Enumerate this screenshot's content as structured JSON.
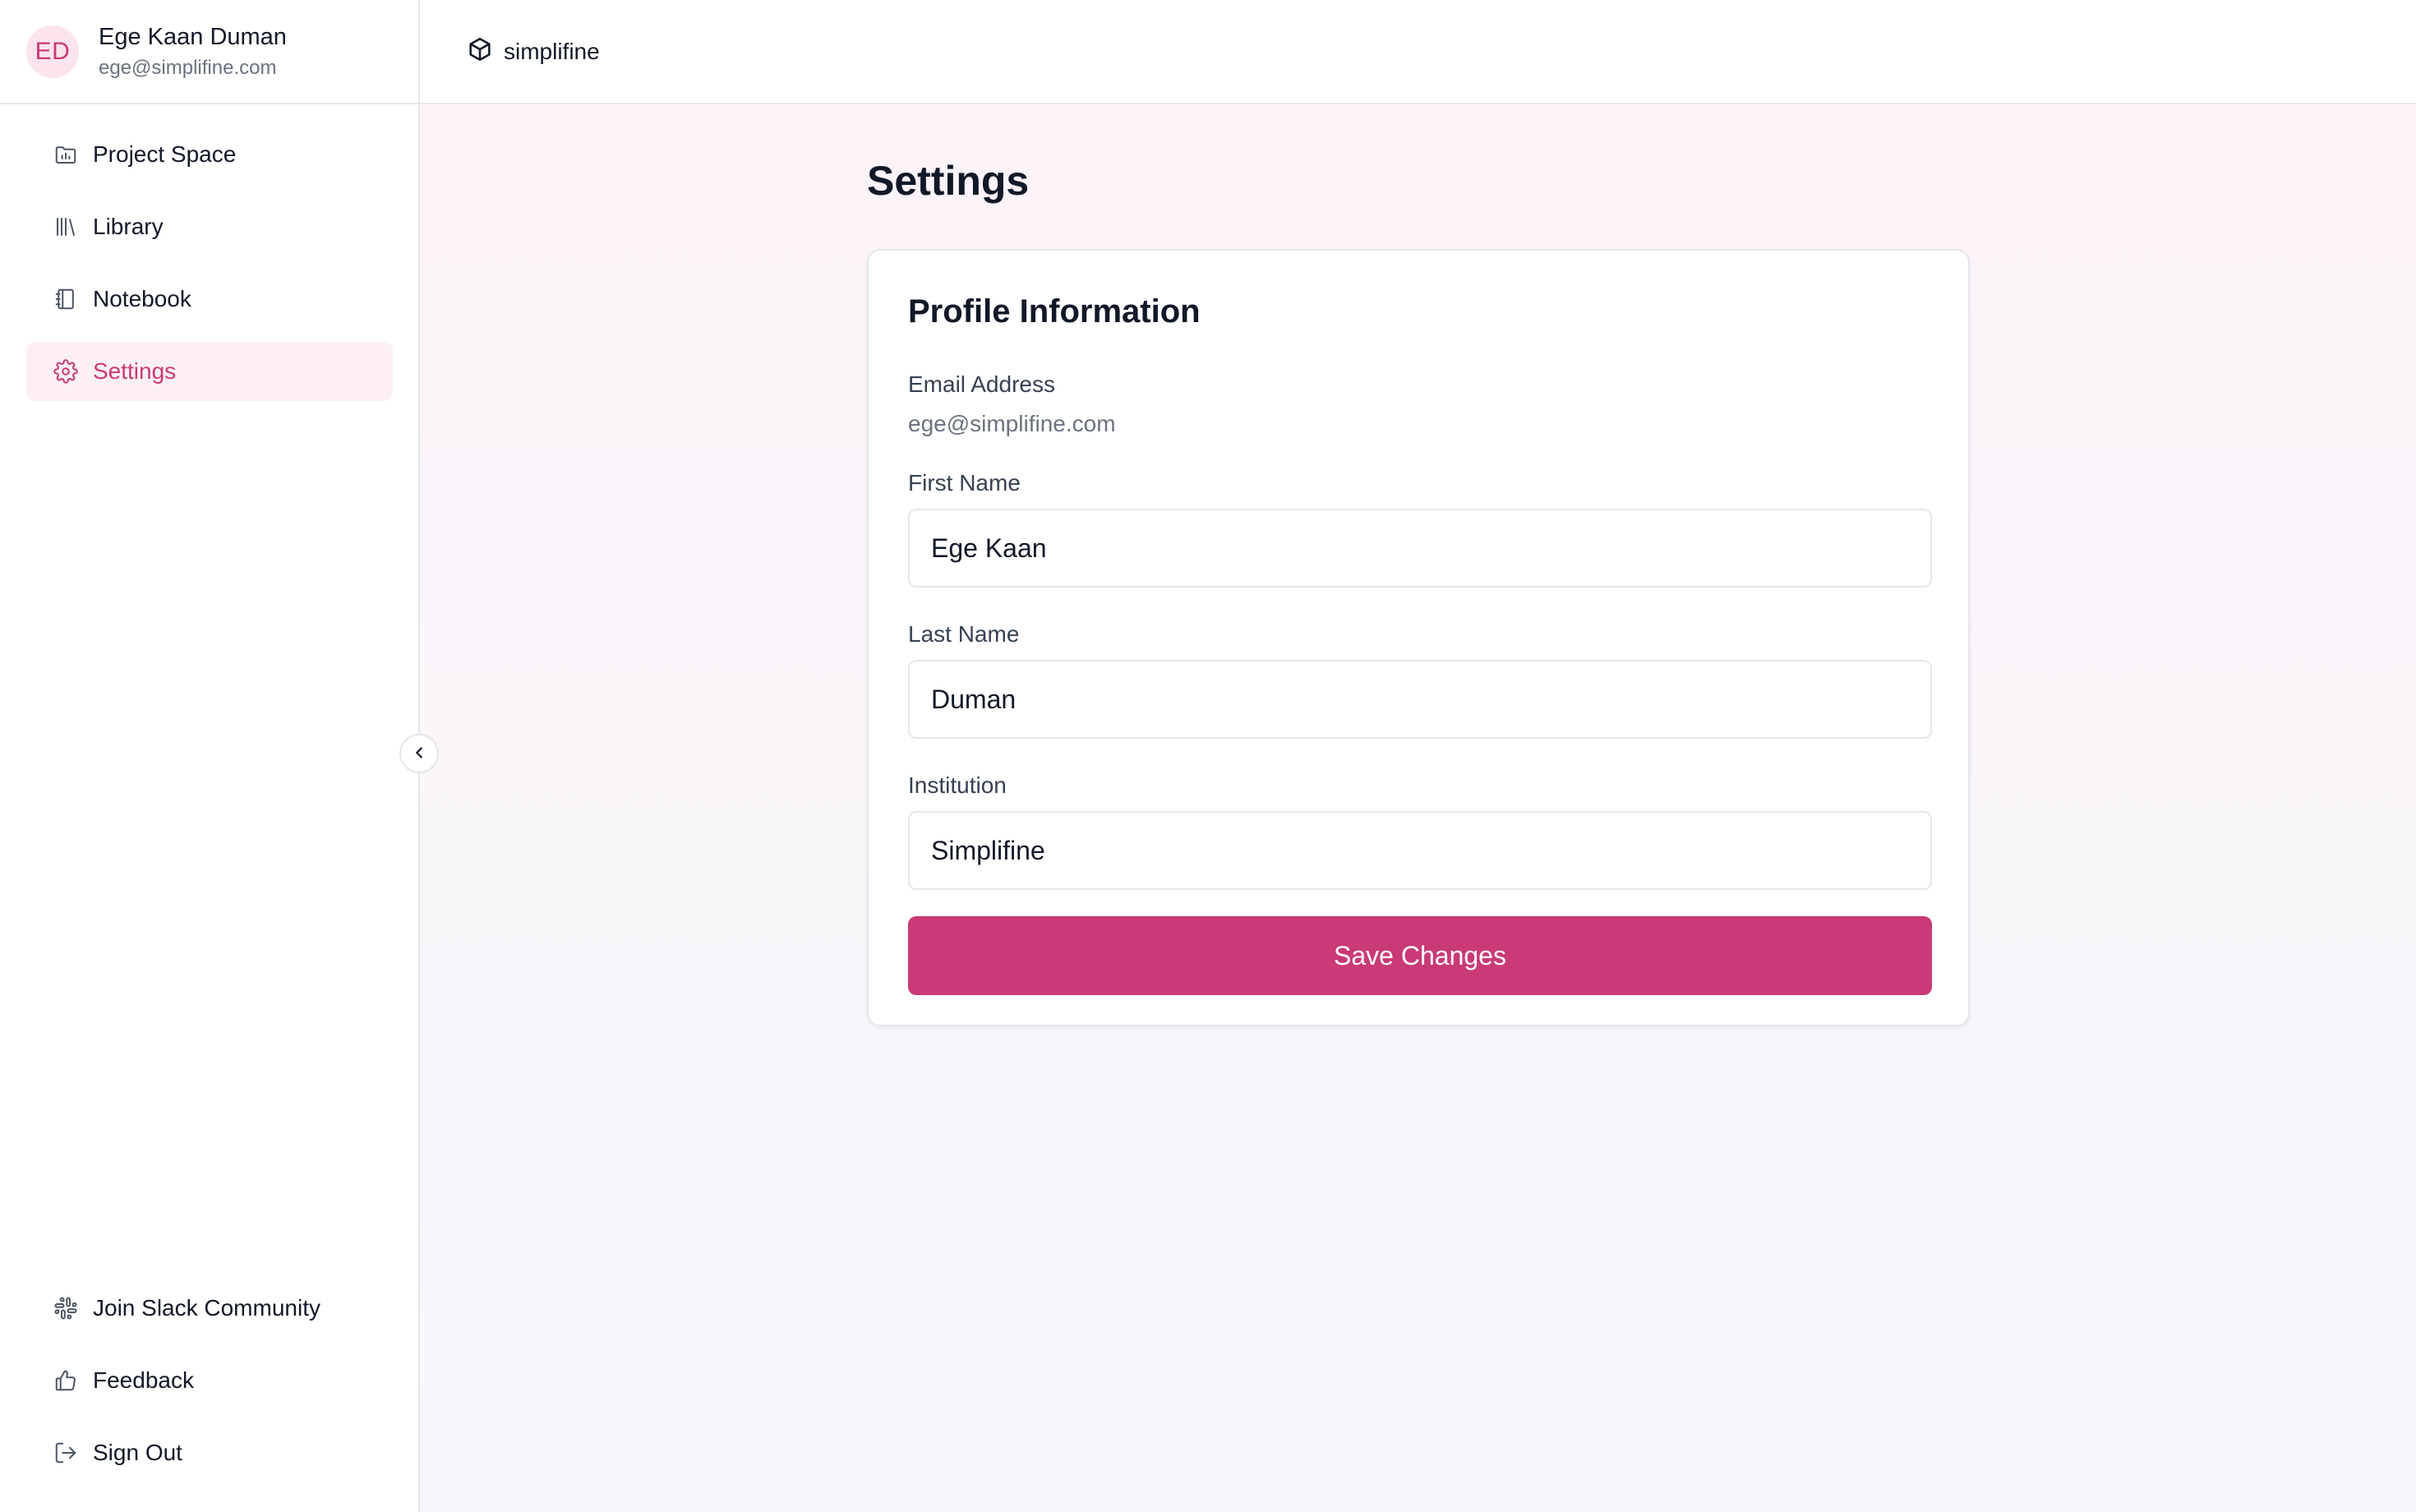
{
  "user": {
    "initials": "ED",
    "name": "Ege Kaan Duman",
    "email": "ege@simplifine.com"
  },
  "brand": {
    "name": "simplifine",
    "icon": "cube-logo-icon"
  },
  "nav": {
    "items": [
      {
        "label": "Project Space",
        "icon": "folder-chart-icon",
        "active": false
      },
      {
        "label": "Library",
        "icon": "library-icon",
        "active": false
      },
      {
        "label": "Notebook",
        "icon": "notebook-icon",
        "active": false
      },
      {
        "label": "Settings",
        "icon": "gear-icon",
        "active": true
      }
    ],
    "bottom": [
      {
        "label": "Join Slack Community",
        "icon": "slack-icon"
      },
      {
        "label": "Feedback",
        "icon": "thumbs-up-icon"
      },
      {
        "label": "Sign Out",
        "icon": "sign-out-icon"
      }
    ],
    "collapse_icon": "chevron-left-icon"
  },
  "page": {
    "title": "Settings"
  },
  "profile": {
    "card_title": "Profile Information",
    "email_label": "Email Address",
    "email_value": "ege@simplifine.com",
    "first_name_label": "First Name",
    "first_name_value": "Ege Kaan",
    "last_name_label": "Last Name",
    "last_name_value": "Duman",
    "institution_label": "Institution",
    "institution_value": "Simplifine",
    "save_label": "Save Changes"
  },
  "colors": {
    "accent": "#c93a76",
    "accent_bg": "#fdf0f5",
    "avatar_bg": "#fbe4ee",
    "border": "#e5e7eb"
  }
}
